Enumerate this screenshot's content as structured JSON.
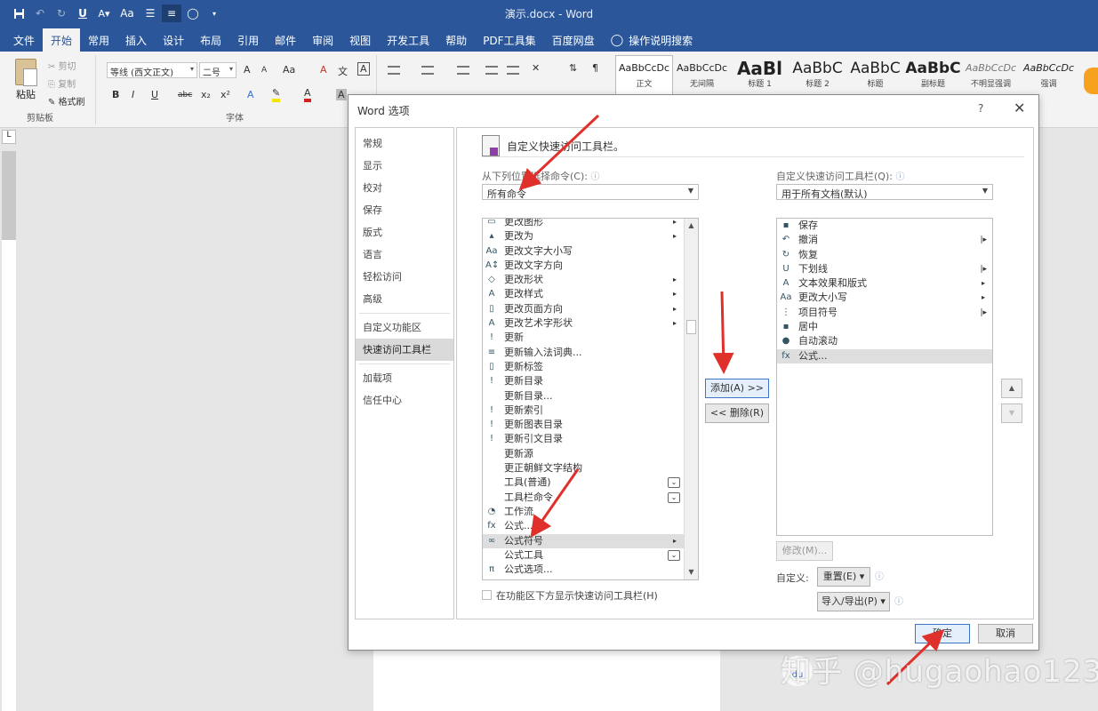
{
  "window": {
    "title": "演示.docx  -  Word",
    "qat_icons": [
      "save-icon",
      "undo-icon",
      "redo-icon",
      "underline-icon",
      "text-effects-icon",
      "change-case-icon",
      "bullets-icon",
      "center-icon",
      "auto-scroll-icon",
      "customize-qat-icon"
    ],
    "qat_labels": {
      "underline": "U",
      "change_case": "Aa"
    }
  },
  "ribbon": {
    "tabs": [
      {
        "label": "文件"
      },
      {
        "label": "开始"
      },
      {
        "label": "常用"
      },
      {
        "label": "插入"
      },
      {
        "label": "设计"
      },
      {
        "label": "布局"
      },
      {
        "label": "引用"
      },
      {
        "label": "邮件"
      },
      {
        "label": "审阅"
      },
      {
        "label": "视图"
      },
      {
        "label": "开发工具"
      },
      {
        "label": "帮助"
      },
      {
        "label": "PDF工具集"
      },
      {
        "label": "百度网盘"
      }
    ],
    "tell_me": "操作说明搜索",
    "active_tab": "开始",
    "clipboard": {
      "paste": "粘贴",
      "cut": "剪切",
      "copy": "复制",
      "format_painter": "格式刷",
      "group": "剪贴板"
    },
    "font": {
      "name": "等线 (西文正文)",
      "size": "二号",
      "group": "字体",
      "buttons": {
        "grow": "A",
        "shrink": "A",
        "case": "Aa",
        "clear": "A",
        "phonetic": "文",
        "border": "A",
        "bold": "B",
        "italic": "I",
        "underline": "U",
        "strike": "abc",
        "sub": "x₂",
        "sup": "x²",
        "color": "A"
      }
    },
    "styles": [
      {
        "sample": "AaBbCcDc",
        "name": "正文"
      },
      {
        "sample": "AaBbCcDc",
        "name": "无间隔"
      },
      {
        "sample": "AaBl",
        "name": "标题 1"
      },
      {
        "sample": "AaBbC",
        "name": "标题 2"
      },
      {
        "sample": "AaBbC",
        "name": "标题"
      },
      {
        "sample": "AaBbC",
        "name": "副标题"
      },
      {
        "sample": "AaBbCcDc",
        "name": "不明显强调"
      },
      {
        "sample": "AaBbCcDc",
        "name": "强调"
      }
    ]
  },
  "dialog": {
    "title": "Word 选项",
    "help": "?",
    "close": "✕",
    "nav": [
      {
        "label": "常规"
      },
      {
        "label": "显示"
      },
      {
        "label": "校对"
      },
      {
        "label": "保存"
      },
      {
        "label": "版式"
      },
      {
        "label": "语言"
      },
      {
        "label": "轻松访问"
      },
      {
        "label": "高级"
      },
      {
        "label": "自定义功能区"
      },
      {
        "label": "快速访问工具栏"
      },
      {
        "label": "加载项"
      },
      {
        "label": "信任中心"
      }
    ],
    "selected_nav": "快速访问工具栏",
    "heading": "自定义快速访问工具栏。",
    "choose_label": "从下列位置选择命令(C):",
    "choose_value": "所有命令",
    "customize_label": "自定义快速访问工具栏(Q):",
    "customize_value": "用于所有文档(默认)",
    "commands": [
      {
        "label": "更改图形",
        "icon": "▭",
        "sub": true
      },
      {
        "label": "更改为",
        "icon": "▴",
        "sub": true
      },
      {
        "label": "更改文字大小写",
        "icon": "Aa"
      },
      {
        "label": "更改文字方向",
        "icon": "A↕"
      },
      {
        "label": "更改形状",
        "icon": "◇",
        "sub": true
      },
      {
        "label": "更改样式",
        "icon": "A",
        "sub": true
      },
      {
        "label": "更改页面方向",
        "icon": "▯",
        "sub": true
      },
      {
        "label": "更改艺术字形状",
        "icon": "A",
        "sub": true
      },
      {
        "label": "更新",
        "icon": "!"
      },
      {
        "label": "更新输入法词典...",
        "icon": "≡"
      },
      {
        "label": "更新标签",
        "icon": "▯"
      },
      {
        "label": "更新目录",
        "icon": "!"
      },
      {
        "label": "更新目录...",
        "icon": ""
      },
      {
        "label": "更新索引",
        "icon": "!"
      },
      {
        "label": "更新图表目录",
        "icon": "!"
      },
      {
        "label": "更新引文目录",
        "icon": "!"
      },
      {
        "label": "更新源",
        "icon": ""
      },
      {
        "label": "更正朝鲜文字结构",
        "icon": ""
      },
      {
        "label": "工具(普通)",
        "icon": "",
        "toggle": true
      },
      {
        "label": "工具栏命令",
        "icon": "",
        "toggle": true
      },
      {
        "label": "工作流",
        "icon": "◔"
      },
      {
        "label": "公式...",
        "icon": "fx"
      },
      {
        "label": "公式符号",
        "icon": "∞",
        "sub": true,
        "selected": true
      },
      {
        "label": "公式工具",
        "icon": "",
        "toggle": true
      },
      {
        "label": "公式选项...",
        "icon": "π"
      }
    ],
    "qat_items": [
      {
        "label": "保存",
        "icon": "▪"
      },
      {
        "label": "撤消",
        "icon": "↶",
        "bar": true
      },
      {
        "label": "恢复",
        "icon": "↻"
      },
      {
        "label": "下划线",
        "icon": "U",
        "bar": true
      },
      {
        "label": "文本效果和版式",
        "icon": "A",
        "sub": true
      },
      {
        "label": "更改大小写",
        "icon": "Aa",
        "sub": true
      },
      {
        "label": "项目符号",
        "icon": "⋮",
        "bar": true
      },
      {
        "label": "居中",
        "icon": "▪"
      },
      {
        "label": "自动滚动",
        "icon": "●"
      },
      {
        "label": "公式...",
        "icon": "fx",
        "selected": true
      }
    ],
    "add_button": "添加(A) >>",
    "remove_button": "<< 删除(R)",
    "modify_button": "修改(M)...",
    "customize_text": "自定义:",
    "reset_button": "重置(E) ▾",
    "import_export_button": "导入/导出(P) ▾",
    "show_below_ribbon": "在功能区下方显示快速访问工具栏(H)",
    "ok_button": "确定",
    "cancel_button": "取消",
    "move_up": "▲",
    "move_down": "▼"
  },
  "watermark": "知乎 @hugaohao123",
  "watermark_badge": "du",
  "ruler_marker": "L",
  "colors": {
    "word_blue": "#2b579a",
    "annotation_red": "#e0302b"
  }
}
